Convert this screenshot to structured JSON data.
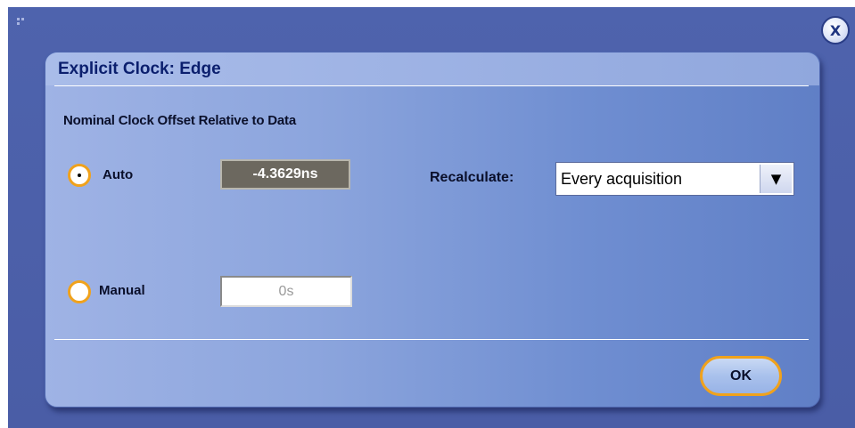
{
  "window": {
    "close_label": "X",
    "corner_icon": "grip-icon"
  },
  "dialog": {
    "title": "Explicit Clock: Edge",
    "section_heading": "Nominal Clock Offset Relative to Data",
    "auto": {
      "label": "Auto",
      "selected": true,
      "value": "-4.3629ns"
    },
    "manual": {
      "label": "Manual",
      "selected": false,
      "value": "0s"
    },
    "recalculate": {
      "label": "Recalculate:",
      "selected_option": "Every acquisition",
      "arrow": "▼"
    },
    "ok_label": "OK"
  },
  "colors": {
    "frame_bg": "#4e63ad",
    "dialog_title": "#0b1f6e",
    "accent_orange": "#f0a21c",
    "readout_bg": "#6c685f"
  }
}
